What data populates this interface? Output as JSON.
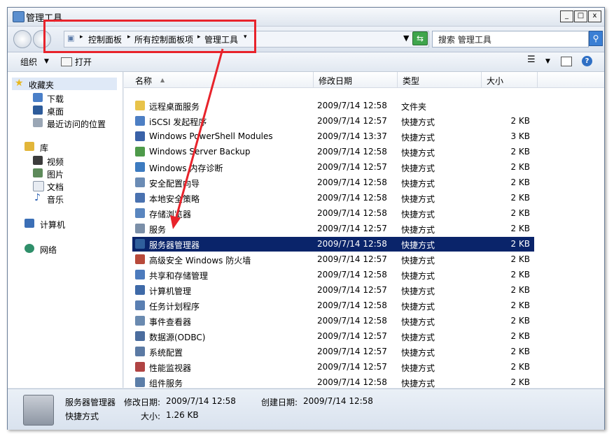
{
  "window": {
    "title": "管理工具",
    "min": "_",
    "max": "□",
    "close": "x"
  },
  "address": {
    "crumbs": [
      "控制面板",
      "所有控制面板项",
      "管理工具"
    ],
    "search_placeholder": "搜索 管理工具"
  },
  "toolbar": {
    "organize": "组织",
    "open": "打开"
  },
  "sidebar": {
    "favorites": "收藏夹",
    "fav_items": [
      "下载",
      "桌面",
      "最近访问的位置"
    ],
    "library": "库",
    "lib_items": [
      "视频",
      "图片",
      "文档",
      "音乐"
    ],
    "computer": "计算机",
    "network": "网络"
  },
  "columns": {
    "name": "名称",
    "date": "修改日期",
    "type": "类型",
    "size": "大小"
  },
  "files": [
    {
      "name": "远程桌面服务",
      "date": "2009/7/14 12:58",
      "type": "文件夹",
      "size": ""
    },
    {
      "name": "iSCSI 发起程序",
      "date": "2009/7/14 12:57",
      "type": "快捷方式",
      "size": "2 KB"
    },
    {
      "name": "Windows PowerShell Modules",
      "date": "2009/7/14 13:37",
      "type": "快捷方式",
      "size": "3 KB"
    },
    {
      "name": "Windows Server Backup",
      "date": "2009/7/14 12:58",
      "type": "快捷方式",
      "size": "2 KB"
    },
    {
      "name": "Windows 内存诊断",
      "date": "2009/7/14 12:57",
      "type": "快捷方式",
      "size": "2 KB"
    },
    {
      "name": "安全配置向导",
      "date": "2009/7/14 12:58",
      "type": "快捷方式",
      "size": "2 KB"
    },
    {
      "name": "本地安全策略",
      "date": "2009/7/14 12:58",
      "type": "快捷方式",
      "size": "2 KB"
    },
    {
      "name": "存储浏览器",
      "date": "2009/7/14 12:58",
      "type": "快捷方式",
      "size": "2 KB"
    },
    {
      "name": "服务",
      "date": "2009/7/14 12:57",
      "type": "快捷方式",
      "size": "2 KB"
    },
    {
      "name": "服务器管理器",
      "date": "2009/7/14 12:58",
      "type": "快捷方式",
      "size": "2 KB"
    },
    {
      "name": "高级安全 Windows 防火墙",
      "date": "2009/7/14 12:57",
      "type": "快捷方式",
      "size": "2 KB"
    },
    {
      "name": "共享和存储管理",
      "date": "2009/7/14 12:58",
      "type": "快捷方式",
      "size": "2 KB"
    },
    {
      "name": "计算机管理",
      "date": "2009/7/14 12:57",
      "type": "快捷方式",
      "size": "2 KB"
    },
    {
      "name": "任务计划程序",
      "date": "2009/7/14 12:58",
      "type": "快捷方式",
      "size": "2 KB"
    },
    {
      "name": "事件查看器",
      "date": "2009/7/14 12:58",
      "type": "快捷方式",
      "size": "2 KB"
    },
    {
      "name": "数据源(ODBC)",
      "date": "2009/7/14 12:57",
      "type": "快捷方式",
      "size": "2 KB"
    },
    {
      "name": "系统配置",
      "date": "2009/7/14 12:57",
      "type": "快捷方式",
      "size": "2 KB"
    },
    {
      "name": "性能监视器",
      "date": "2009/7/14 12:57",
      "type": "快捷方式",
      "size": "2 KB"
    },
    {
      "name": "组件服务",
      "date": "2009/7/14 12:58",
      "type": "快捷方式",
      "size": "2 KB"
    }
  ],
  "status": {
    "name": "服务器管理器",
    "modified_label": "修改日期:",
    "modified": "2009/7/14 12:58",
    "created_label": "创建日期:",
    "created": "2009/7/14 12:58",
    "type": "快捷方式",
    "size_label": "大小:",
    "size": "1.26 KB"
  },
  "colors": {
    "selection": "#0a246a",
    "highlight_box": "#e8232b"
  }
}
